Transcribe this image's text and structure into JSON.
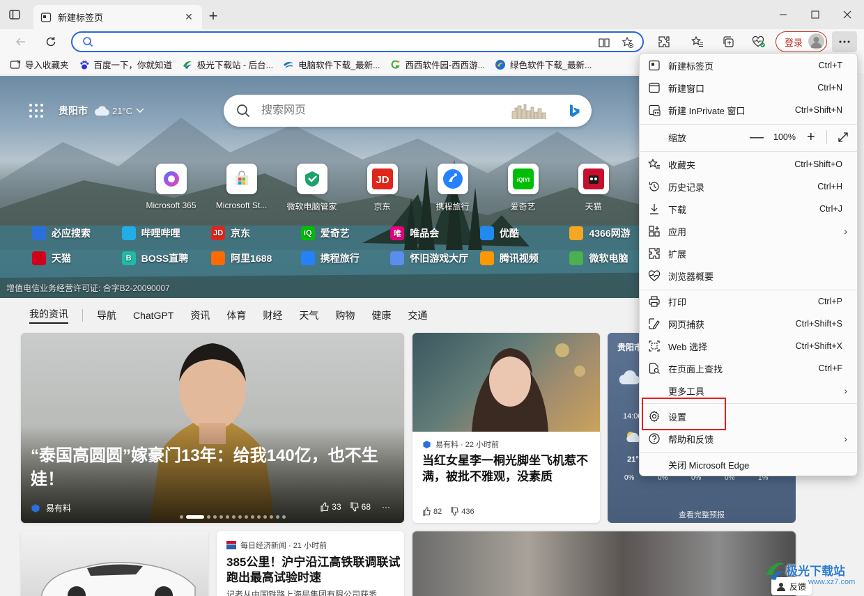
{
  "browser": {
    "tab_title": "新建标签页",
    "address_value": "",
    "login_label": "登录",
    "bookmarks": [
      {
        "label": "导入收藏夹"
      },
      {
        "label": "百度一下，你就知道"
      },
      {
        "label": "极光下载站 - 后台..."
      },
      {
        "label": "电脑软件下载_最新..."
      },
      {
        "label": "西西软件园-西西游..."
      },
      {
        "label": "绿色软件下载_最新..."
      }
    ]
  },
  "hero": {
    "city": "贵阳市",
    "temperature": "21°C",
    "search_placeholder": "搜索网页",
    "tiles": [
      {
        "label": "Microsoft 365"
      },
      {
        "label": "Microsoft St..."
      },
      {
        "label": "微软电脑管家"
      },
      {
        "label": "京东"
      },
      {
        "label": "携程旅行"
      },
      {
        "label": "爱奇艺"
      },
      {
        "label": "天猫"
      }
    ],
    "quicklinks_row1": [
      {
        "label": "必应搜索",
        "icon_text": "",
        "color": "#2a6fdb"
      },
      {
        "label": "哔哩哔哩",
        "icon_text": "",
        "color": "#23ade5"
      },
      {
        "label": "京东",
        "icon_text": "JD",
        "color": "#e1251b"
      },
      {
        "label": "爱奇艺",
        "icon_text": "iQ",
        "color": "#00be06"
      },
      {
        "label": "唯品会",
        "icon_text": "唯",
        "color": "#e4007f"
      },
      {
        "label": "优酷",
        "icon_text": "",
        "color": "#1f8bf0"
      },
      {
        "label": "4366网游",
        "icon_text": "",
        "color": "#f5a623"
      }
    ],
    "quicklinks_row2": [
      {
        "label": "天猫",
        "icon_text": "",
        "color": "#d0021b"
      },
      {
        "label": "BOSS直聘",
        "icon_text": "B",
        "color": "#1fbba6"
      },
      {
        "label": "阿里1688",
        "icon_text": "",
        "color": "#ff6a00"
      },
      {
        "label": "携程旅行",
        "icon_text": "",
        "color": "#2681ff"
      },
      {
        "label": "怀旧游戏大厅",
        "icon_text": "",
        "color": "#5b8def"
      },
      {
        "label": "腾讯视频",
        "icon_text": "",
        "color": "#ff9800"
      },
      {
        "label": "微软电脑",
        "icon_text": "",
        "color": "#4caf50"
      }
    ],
    "license": "增值电信业务经营许可证: 合字B2-20090007"
  },
  "newsnav": {
    "active": "我的资讯",
    "items": [
      "导航",
      "ChatGPT",
      "资讯",
      "体育",
      "财经",
      "天气",
      "购物",
      "健康",
      "交通"
    ]
  },
  "cards": {
    "big": {
      "headline": "“泰国高圆圆”嫁豪门13年：给我140亿，也不生娃！",
      "source": "易有料",
      "likes": "33",
      "dislikes": "68"
    },
    "second": {
      "source": "易有料 · 22 小时前",
      "title": "当红女星李一桐光脚坐飞机惹不满，被批不雅观，没素质",
      "likes": "82",
      "dislikes": "436"
    },
    "weather": {
      "city": "贵阳市",
      "time": "14:00",
      "temp": "21°",
      "precip": [
        "0%",
        "0%",
        "0%",
        "0%",
        "1%"
      ],
      "forecast_label": "查看完整预报"
    },
    "fifth": {
      "source": "每日经济新闻 · 21 小时前",
      "title": "385公里！沪宁沿江高铁联调联试跑出最高试验时速",
      "snippet": "记者从中国铁路上海局集团有限公司获悉"
    },
    "feedback_label": "反馈"
  },
  "menu": {
    "items": [
      {
        "label": "新建标签页",
        "shortcut": "Ctrl+T",
        "icon": "new-tab-icon"
      },
      {
        "label": "新建窗口",
        "shortcut": "Ctrl+N",
        "icon": "new-window-icon"
      },
      {
        "label": "新建 InPrivate 窗口",
        "shortcut": "Ctrl+Shift+N",
        "icon": "inprivate-icon"
      },
      {
        "label": "缩放",
        "zoom": "100%"
      },
      {
        "label": "收藏夹",
        "shortcut": "Ctrl+Shift+O",
        "icon": "favorites-icon"
      },
      {
        "label": "历史记录",
        "shortcut": "Ctrl+H",
        "icon": "history-icon"
      },
      {
        "label": "下载",
        "shortcut": "Ctrl+J",
        "icon": "download-icon"
      },
      {
        "label": "应用",
        "arrow": true,
        "icon": "apps-icon"
      },
      {
        "label": "扩展",
        "icon": "extensions-icon"
      },
      {
        "label": "浏览器概要",
        "icon": "browser-essentials-icon"
      },
      {
        "label": "打印",
        "shortcut": "Ctrl+P",
        "icon": "print-icon"
      },
      {
        "label": "网页捕获",
        "shortcut": "Ctrl+Shift+S",
        "icon": "web-capture-icon"
      },
      {
        "label": "Web 选择",
        "shortcut": "Ctrl+Shift+X",
        "icon": "web-select-icon"
      },
      {
        "label": "在页面上查找",
        "shortcut": "Ctrl+F",
        "icon": "find-icon"
      },
      {
        "label": "更多工具",
        "arrow": true,
        "icon": "more-tools-icon"
      },
      {
        "label": "设置",
        "icon": "settings-icon"
      },
      {
        "label": "帮助和反馈",
        "arrow": true,
        "icon": "help-icon"
      },
      {
        "label": "关闭 Microsoft Edge",
        "icon": "close-edge-icon"
      }
    ],
    "zoom_minus": "—",
    "zoom_plus": "+"
  },
  "watermark": {
    "text": "极光下载站",
    "url": "www.xz7.com"
  },
  "colors": {
    "accent": "#2a66d9",
    "login": "#c42b1c",
    "highlight": "#e0201b"
  }
}
